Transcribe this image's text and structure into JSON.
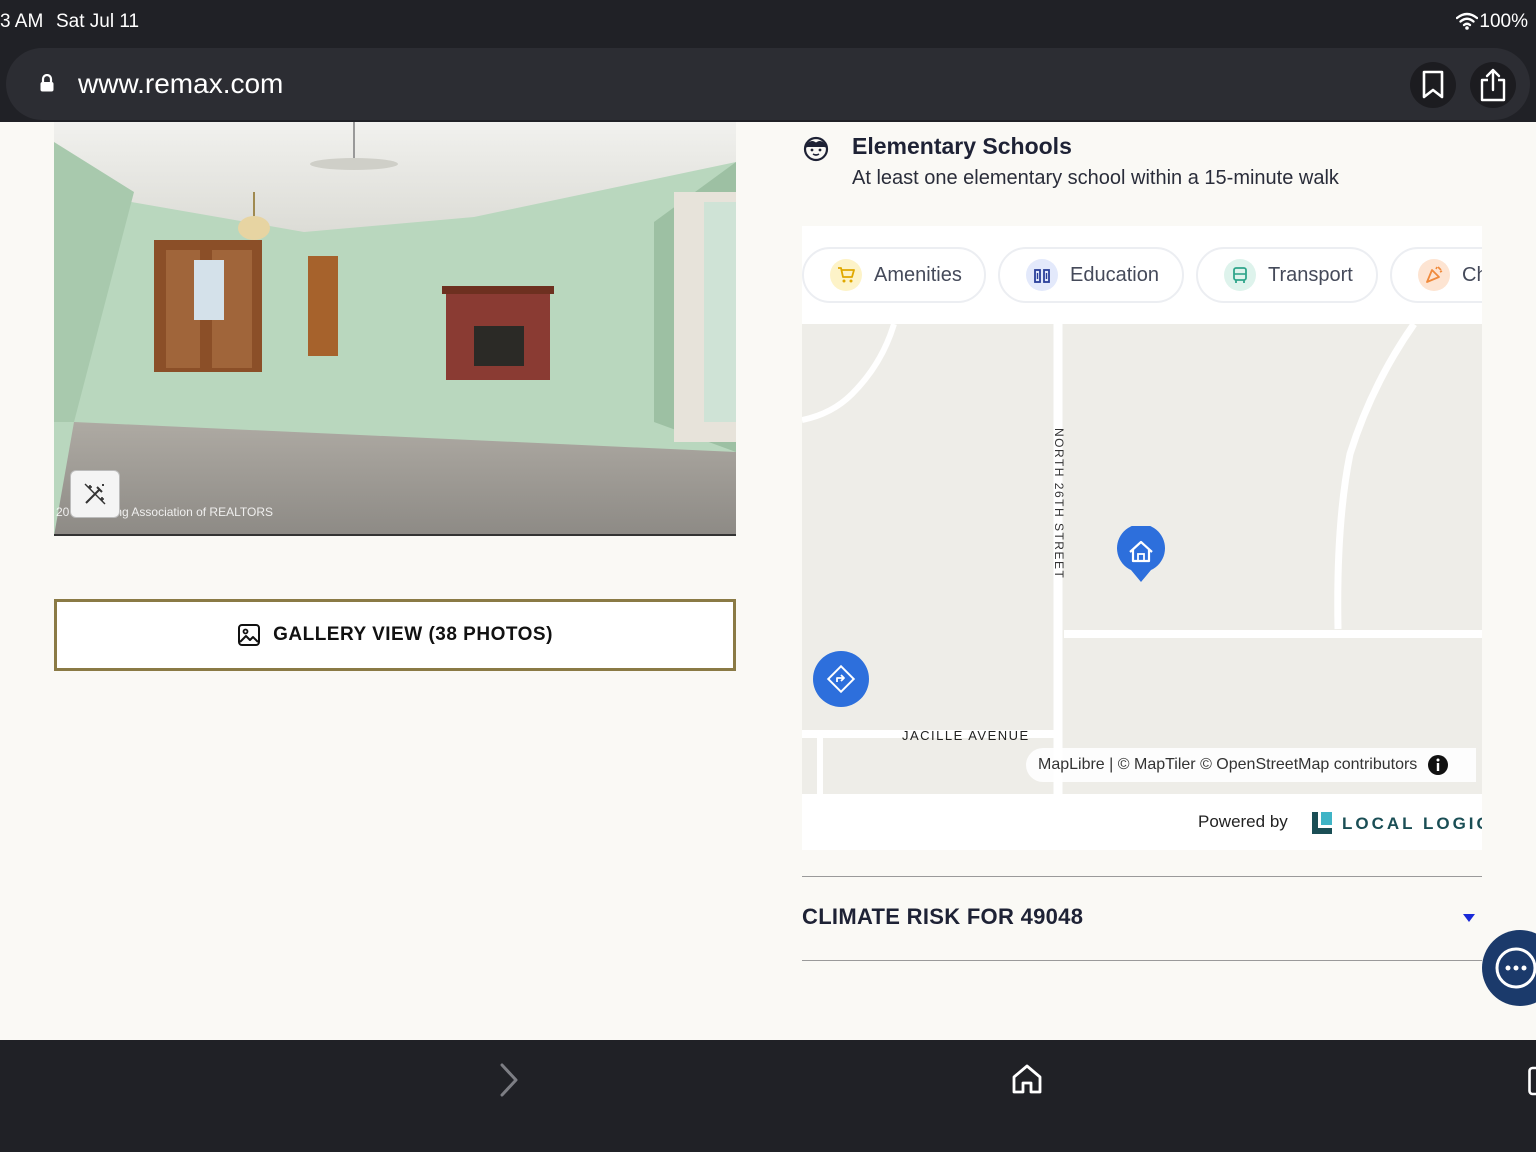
{
  "status_bar": {
    "time": "3 AM",
    "date": "Sat Jul 11",
    "battery": "100%"
  },
  "browser": {
    "url": "www.remax.com"
  },
  "photo": {
    "caption": "20    er Lansing Association of REALTORS"
  },
  "gallery": {
    "label": "GALLERY VIEW (38 PHOTOS)"
  },
  "schools": {
    "title": "Elementary Schools",
    "description": "At least one elementary school within a 15-minute walk"
  },
  "chips": [
    {
      "label": "Amenities",
      "icon": "cart-icon",
      "color": "#f3c61a"
    },
    {
      "label": "Education",
      "icon": "school-icon",
      "color": "#3b5bdb"
    },
    {
      "label": "Transport",
      "icon": "bus-icon",
      "color": "#2ea58a"
    },
    {
      "label": "Ch",
      "icon": "party-icon",
      "color": "#f08a3c"
    }
  ],
  "map": {
    "street_vertical": "NORTH 26TH STREET",
    "street_horizontal": "JACILLE AVENUE",
    "attribution": "MapLibre | © MapTiler © OpenStreetMap contributors",
    "pin_color": "#2d6fdc"
  },
  "powered_by": {
    "label": "Powered by",
    "brand": "LOCAL LOGIC"
  },
  "climate": {
    "title": "CLIMATE RISK FOR 49048"
  }
}
